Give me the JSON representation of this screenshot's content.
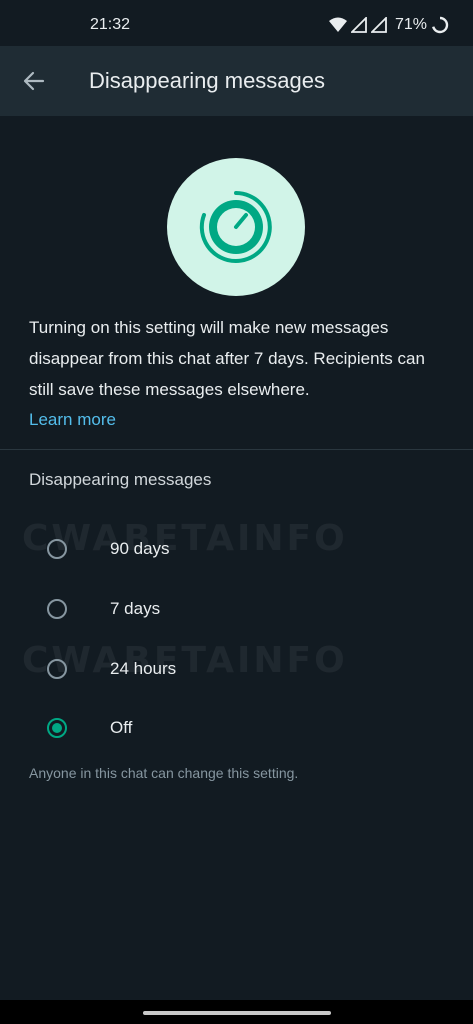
{
  "status_bar": {
    "time": "21:32",
    "battery": "71%",
    "icons": [
      "wifi-icon",
      "signal-icon",
      "signal-icon",
      "battery-ring-icon"
    ]
  },
  "app_bar": {
    "title": "Disappearing messages",
    "back_icon": "arrow-back-icon"
  },
  "hero": {
    "icon": "timer-icon"
  },
  "description": "Turning on this setting will make new messages disappear from this chat after 7 days. Recipients can still save these messages elsewhere.",
  "learn_more": "Learn more",
  "section_label": "Disappearing messages",
  "options": [
    {
      "label": "90 days",
      "selected": false
    },
    {
      "label": "7 days",
      "selected": false
    },
    {
      "label": "24 hours",
      "selected": false
    },
    {
      "label": "Off",
      "selected": true
    }
  ],
  "footnote": "Anyone in this chat can change this setting.",
  "watermark": "CWABETAINFO",
  "colors": {
    "background": "#121b22",
    "app_bar": "#1f2c34",
    "accent": "#00a884",
    "link": "#53bdeb",
    "hero_bg": "#d1f4e8"
  }
}
